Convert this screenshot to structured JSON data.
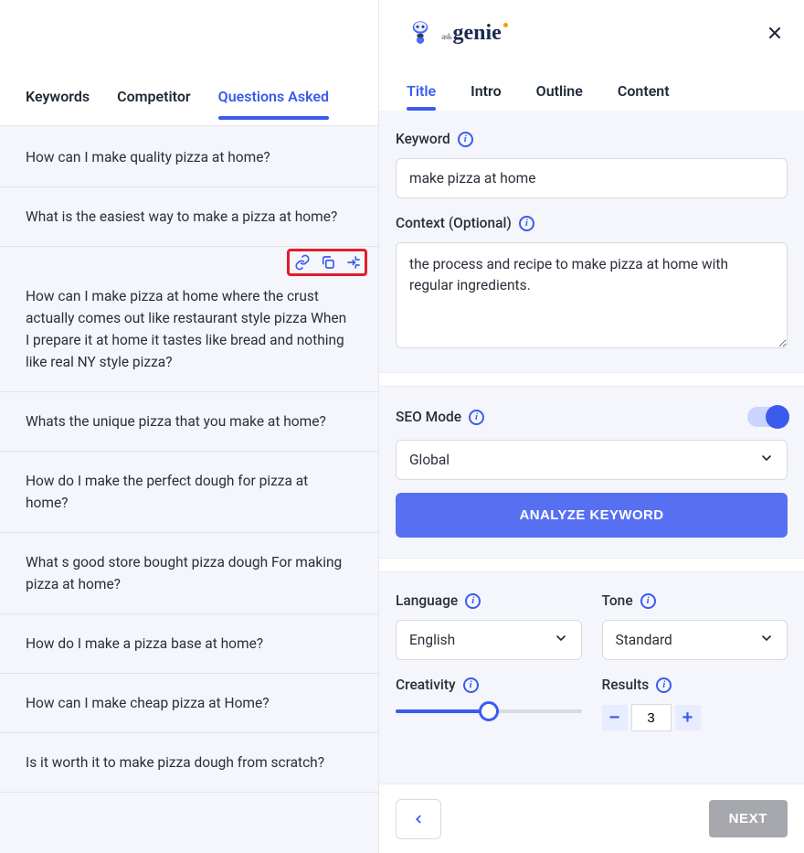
{
  "brand": {
    "name": "genie",
    "prefix": "ask"
  },
  "left": {
    "tabs": [
      "Keywords",
      "Competitor",
      "Questions Asked"
    ],
    "active_tab": "Questions Asked",
    "questions": [
      "How can I make quality pizza at home?",
      "What is the easiest way to make a pizza at home?",
      "How can I make pizza at home where the crust actually comes out like restaurant style pizza When I prepare it at home it tastes like bread and nothing like real NY style pizza?",
      "Whats the unique pizza that you make at home?",
      "How do I make the perfect dough for pizza at home?",
      "What s good store bought pizza dough For making pizza at home?",
      "How do I make a pizza base at home?",
      "How can I make cheap pizza at Home?",
      "Is it worth it to make pizza dough from scratch?"
    ]
  },
  "right": {
    "tabs": [
      "Title",
      "Intro",
      "Outline",
      "Content"
    ],
    "active_tab": "Title",
    "keyword_label": "Keyword",
    "keyword_value": "make pizza at home",
    "context_label": "Context (Optional)",
    "context_value": "the process and recipe to make pizza at home with regular ingredients.",
    "seo_label": "SEO Mode",
    "seo_on": true,
    "region_value": "Global",
    "analyze_label": "ANALYZE KEYWORD",
    "language_label": "Language",
    "language_value": "English",
    "tone_label": "Tone",
    "tone_value": "Standard",
    "creativity_label": "Creativity",
    "creativity_value": 0.5,
    "results_label": "Results",
    "results_value": "3",
    "next_label": "NEXT"
  }
}
